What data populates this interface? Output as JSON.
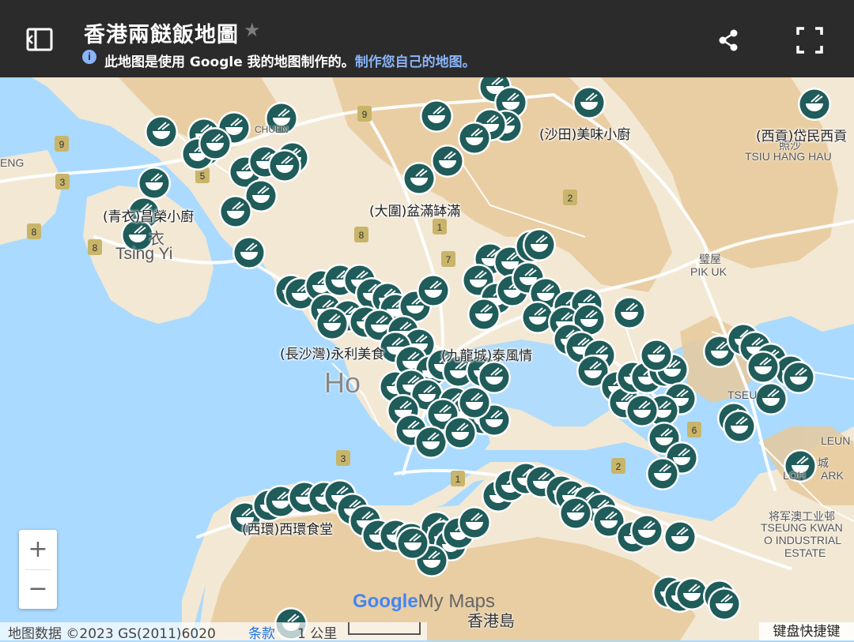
{
  "header": {
    "title": "香港兩餸飯地圖",
    "subtitle_prefix": "此地图是使用 Google 我的地图制作的。",
    "subtitle_link": "制作您自己的地图。"
  },
  "labels": {
    "shatin": "(沙田)美味小廚",
    "saikung": "(西貢)岱民西貢",
    "tsingyi": "(青衣)昌榮小廚",
    "taiwai": "(大圍)盆滿缽滿",
    "cheungshawan": "(長沙灣)永利美食",
    "kowlooncity": "(九龍城)泰風情",
    "saiwan": "(西環)西環食堂"
  },
  "places": {
    "tsing_yi": "Tsing Yi",
    "tsing_yi_cn": "衣",
    "pik_uk_cn": "璧屋",
    "pik_uk": "PIK UK",
    "tsiu_hang_hau": "TSIU HANG HAU",
    "tsiu_hang_hau_cn": "照沙",
    "hk_island": "香港島",
    "hong_kong": "Ho",
    "leung": "LEUN",
    "lohas": "LOH",
    "park": "ARK",
    "tko_cn": "将军澳工业邨",
    "tko1": "TSEUNG KWAN",
    "tko2": "O INDUSTRIAL",
    "tko3": "ESTATE",
    "tseung": "TSEU",
    "chuen": "CHUEN",
    "eng": "ENG",
    "cheng": "城"
  },
  "controls": {
    "zoom_in": "+",
    "zoom_out": "−"
  },
  "footer": {
    "data": "地图数据 ©2023 GS(2011)6020",
    "terms": "条款",
    "scale": "1 公里",
    "shortcuts": "键盘快捷键"
  },
  "logo": {
    "google": "Google",
    "mymaps": "My Maps"
  },
  "colors": {
    "marker": "#1f5c5a",
    "header_bg": "#2b2b2b",
    "land": "#f3e9d6",
    "water": "#aadaff",
    "relief": "#e6c79a"
  },
  "icons": {
    "marker": "bowl-icon",
    "sidebar": "sidebar-icon",
    "share": "share-icon",
    "fullscreen": "fullscreen-icon",
    "star": "star-icon"
  }
}
